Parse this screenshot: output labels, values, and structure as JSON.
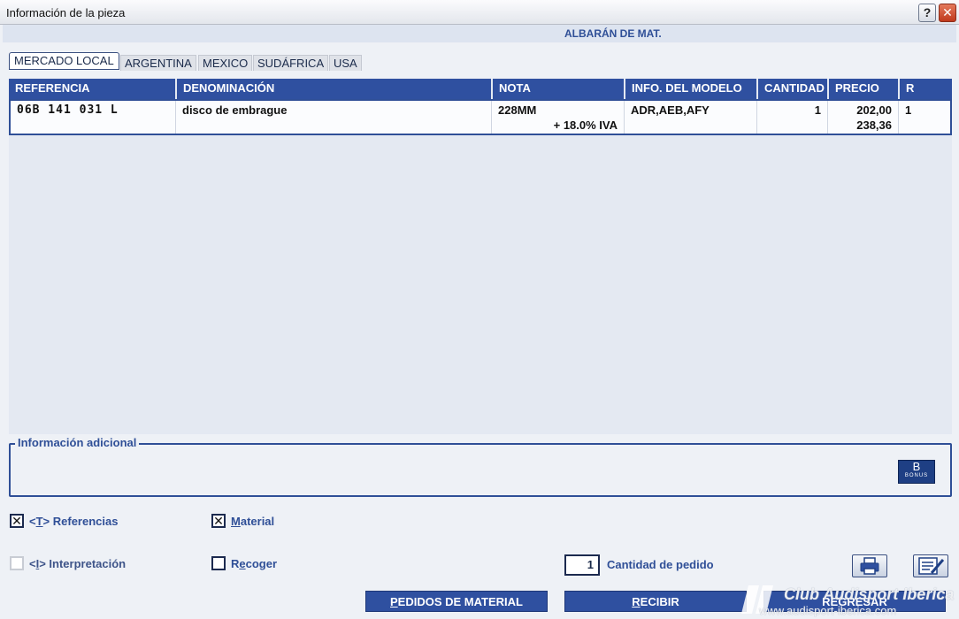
{
  "window": {
    "title": "Información de la pieza",
    "help_label": "?",
    "close_label": "✕"
  },
  "document_title": "ALBARÁN DE MAT.",
  "tabs": [
    {
      "label": "MERCADO LOCAL",
      "active": true
    },
    {
      "label": "ARGENTINA",
      "active": false
    },
    {
      "label": "MEXICO",
      "active": false
    },
    {
      "label": "SUDÁFRICA",
      "active": false
    },
    {
      "label": "USA",
      "active": false
    }
  ],
  "table": {
    "columns": [
      "REFERENCIA",
      "DENOMINACIÓN",
      "NOTA",
      "INFO. DEL MODELO",
      "CANTIDAD",
      "PRECIO",
      "R"
    ],
    "rows": [
      {
        "referencia": "06B 141 031 L",
        "denominacion": "disco de embrague",
        "nota": "228MM",
        "nota_extra": "+ 18.0% IVA",
        "info_modelo": "ADR,AEB,AFY",
        "cantidad": "1",
        "precio": "202,00",
        "precio_iva": "238,36",
        "r": "1"
      }
    ]
  },
  "info_adicional": {
    "legend": "Información adicional",
    "bonus_letter": "B",
    "bonus_text": "BONUS"
  },
  "checkboxes": {
    "referencias": {
      "prefix": "<",
      "key": "T",
      "suffix": "> Referencias",
      "checked": true
    },
    "material": {
      "key": "M",
      "rest": "aterial",
      "checked": true
    },
    "interpretacion": {
      "prefix": "<",
      "key": "I",
      "suffix": "> Interpretación",
      "checked": false,
      "disabled": true
    },
    "recoger": {
      "pre": "R",
      "key": "e",
      "rest": "coger",
      "checked": false
    },
    "check_mark": "✕"
  },
  "order_quantity": {
    "value": "1",
    "label": "Cantidad de pedido"
  },
  "buttons": {
    "pedidos": {
      "key": "P",
      "rest": "EDIDOS DE MATERIAL"
    },
    "recibir": {
      "key": "R",
      "rest": "ECIBIR"
    },
    "regresar": "REGRESAR"
  },
  "watermark": {
    "line1": "Club Audisport Iberica",
    "line2": "www.audisport-iberica.com"
  },
  "colors": {
    "accent": "#2f50a0",
    "header_text": "#2f4f97",
    "background": "#eef1f6"
  }
}
